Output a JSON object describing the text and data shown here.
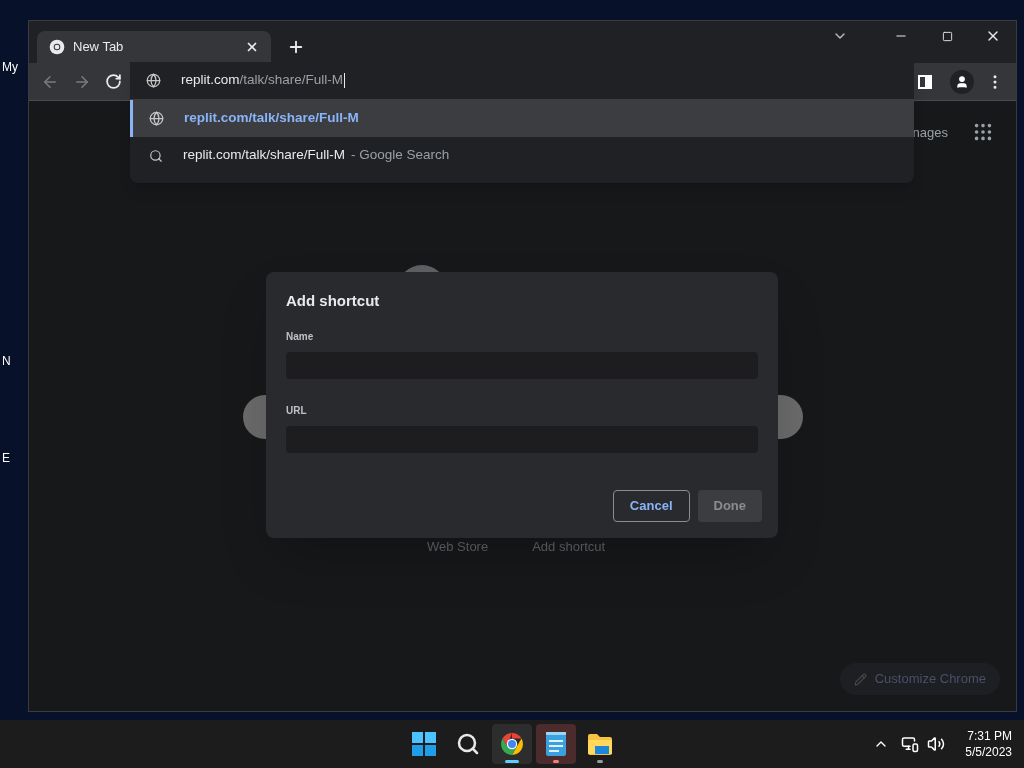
{
  "desktop": {
    "icon_labels": [
      "My",
      "N",
      "E"
    ]
  },
  "browser": {
    "tabs": [
      {
        "title": "New Tab",
        "selected": true
      }
    ],
    "address_bar": {
      "host": "replit.com",
      "path": "/talk/share/Full-M"
    },
    "suggestions": [
      {
        "kind": "url",
        "text": "replit.com/talk/share/Full-M",
        "selected": true
      },
      {
        "kind": "search",
        "text": "replit.com/talk/share/Full-M",
        "suffix": "- Google Search",
        "selected": false
      }
    ],
    "new_tab_page": {
      "header_link": "nages",
      "links": [
        "Web Store",
        "Add shortcut"
      ],
      "customize_button": "Customize Chrome"
    }
  },
  "dialog": {
    "title": "Add shortcut",
    "fields": [
      {
        "label": "Name"
      },
      {
        "label": "URL"
      }
    ],
    "buttons": [
      {
        "label": "Cancel",
        "kind": "secondary",
        "disabled": false
      },
      {
        "label": "Done",
        "kind": "primary",
        "disabled": true
      }
    ]
  },
  "taskbar": {
    "apps": [
      {
        "kind": "start",
        "running": false,
        "active": false,
        "attention": false
      },
      {
        "kind": "search",
        "running": false,
        "active": false,
        "attention": false
      },
      {
        "kind": "chrome",
        "running": true,
        "active": true,
        "attention": false
      },
      {
        "kind": "notepad",
        "running": true,
        "active": false,
        "attention": true
      },
      {
        "kind": "explorer",
        "running": true,
        "active": false,
        "attention": false
      }
    ],
    "time": "7:31 PM",
    "date": "5/5/2023"
  }
}
